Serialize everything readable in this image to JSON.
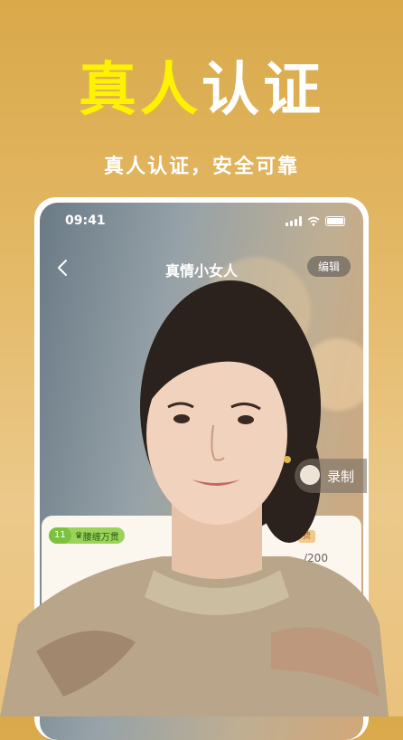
{
  "promo": {
    "headline_part1": "真人",
    "headline_part2": "认证",
    "subtitle": "真人认证，安全可靠"
  },
  "status_bar": {
    "time": "09:41"
  },
  "nav": {
    "title": "真情小女人",
    "edit_label": "编辑"
  },
  "record": {
    "label": "录制"
  },
  "card": {
    "level_number": "11",
    "level_label": "腰缠万贯",
    "right_tag": "费",
    "count_fragment": "/200"
  },
  "colors": {
    "background_top": "#d9a94a",
    "background_bottom": "#e9c27d",
    "headline_yellow": "#fff200",
    "headline_white": "#ffffff",
    "level_tag_green": "#9bd35a"
  },
  "icons": [
    "back-arrow-icon",
    "signal-icon",
    "wifi-icon",
    "battery-icon",
    "record-icon",
    "crown-icon"
  ]
}
